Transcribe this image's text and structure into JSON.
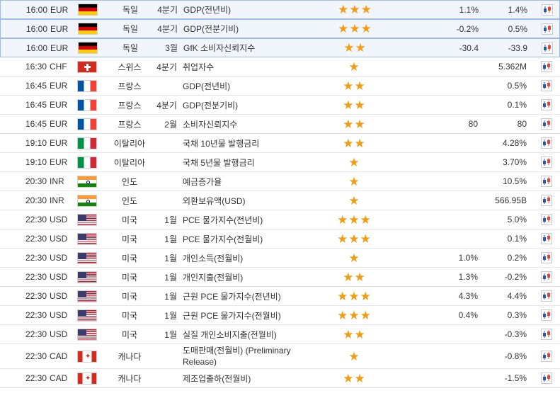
{
  "colors": {
    "star": "#f39c12",
    "row_border": "#e2e4e8",
    "highlight_bg": "#f1f6fd",
    "highlight_border": "#9fbde6"
  },
  "icons": {
    "importance": "star-icon",
    "chart": "candlestick-chart-icon"
  },
  "rows": [
    {
      "time": "16:00",
      "currency": "EUR",
      "flag": "de",
      "country": "독일",
      "period": "4분기",
      "event": "GDP(전년비)",
      "importance": 3,
      "actual": "1.1%",
      "forecast": "1.4%",
      "highlight": true
    },
    {
      "time": "16:00",
      "currency": "EUR",
      "flag": "de",
      "country": "독일",
      "period": "4분기",
      "event": "GDP(전분기비)",
      "importance": 3,
      "actual": "-0.2%",
      "forecast": "0.5%",
      "highlight": true
    },
    {
      "time": "16:00",
      "currency": "EUR",
      "flag": "de",
      "country": "독일",
      "period": "3월",
      "event": "GfK 소비자신뢰지수",
      "importance": 2,
      "actual": "-30.4",
      "forecast": "-33.9",
      "highlight": true
    },
    {
      "time": "16:30",
      "currency": "CHF",
      "flag": "ch",
      "country": "스위스",
      "period": "4분기",
      "event": "취업자수",
      "importance": 1,
      "actual": "",
      "forecast": "5.362M",
      "highlight": false
    },
    {
      "time": "16:45",
      "currency": "EUR",
      "flag": "fr",
      "country": "프랑스",
      "period": "",
      "event": "GDP(전년비)",
      "importance": 2,
      "actual": "",
      "forecast": "0.5%",
      "highlight": false
    },
    {
      "time": "16:45",
      "currency": "EUR",
      "flag": "fr",
      "country": "프랑스",
      "period": "4분기",
      "event": "GDP(전분기비)",
      "importance": 2,
      "actual": "",
      "forecast": "0.1%",
      "highlight": false
    },
    {
      "time": "16:45",
      "currency": "EUR",
      "flag": "fr",
      "country": "프랑스",
      "period": "2월",
      "event": "소비자신뢰지수",
      "importance": 2,
      "actual": "80",
      "forecast": "80",
      "highlight": false
    },
    {
      "time": "19:10",
      "currency": "EUR",
      "flag": "it",
      "country": "이탈리아",
      "period": "",
      "event": "국채 10년물 발행금리",
      "importance": 2,
      "actual": "",
      "forecast": "4.28%",
      "highlight": false
    },
    {
      "time": "19:10",
      "currency": "EUR",
      "flag": "it",
      "country": "이탈리아",
      "period": "",
      "event": "국채 5년물 발행금리",
      "importance": 1,
      "actual": "",
      "forecast": "3.70%",
      "highlight": false
    },
    {
      "time": "20:30",
      "currency": "INR",
      "flag": "in",
      "country": "인도",
      "period": "",
      "event": "예금증가율",
      "importance": 1,
      "actual": "",
      "forecast": "10.5%",
      "highlight": false
    },
    {
      "time": "20:30",
      "currency": "INR",
      "flag": "in",
      "country": "인도",
      "period": "",
      "event": "외환보유액(USD)",
      "importance": 1,
      "actual": "",
      "forecast": "566.95B",
      "highlight": false
    },
    {
      "time": "22:30",
      "currency": "USD",
      "flag": "us",
      "country": "미국",
      "period": "1월",
      "event": "PCE 물가지수(전년비)",
      "importance": 3,
      "actual": "",
      "forecast": "5.0%",
      "highlight": false
    },
    {
      "time": "22:30",
      "currency": "USD",
      "flag": "us",
      "country": "미국",
      "period": "1월",
      "event": "PCE 물가지수(전월비)",
      "importance": 3,
      "actual": "",
      "forecast": "0.1%",
      "highlight": false
    },
    {
      "time": "22:30",
      "currency": "USD",
      "flag": "us",
      "country": "미국",
      "period": "1월",
      "event": "개인소득(전월비)",
      "importance": 1,
      "actual": "1.0%",
      "forecast": "0.2%",
      "highlight": false
    },
    {
      "time": "22:30",
      "currency": "USD",
      "flag": "us",
      "country": "미국",
      "period": "1월",
      "event": "개인지출(전월비)",
      "importance": 2,
      "actual": "1.3%",
      "forecast": "-0.2%",
      "highlight": false
    },
    {
      "time": "22:30",
      "currency": "USD",
      "flag": "us",
      "country": "미국",
      "period": "1월",
      "event": "근원 PCE 물가지수(전년비)",
      "importance": 3,
      "actual": "4.3%",
      "forecast": "4.4%",
      "highlight": false
    },
    {
      "time": "22:30",
      "currency": "USD",
      "flag": "us",
      "country": "미국",
      "period": "1월",
      "event": "근원 PCE 물가지수(전월비)",
      "importance": 3,
      "actual": "0.4%",
      "forecast": "0.3%",
      "highlight": false
    },
    {
      "time": "22:30",
      "currency": "USD",
      "flag": "us",
      "country": "미국",
      "period": "1월",
      "event": "실질 개인소비지출(전월비)",
      "importance": 2,
      "actual": "",
      "forecast": "-0.3%",
      "highlight": false
    },
    {
      "time": "22:30",
      "currency": "CAD",
      "flag": "ca",
      "country": "캐나다",
      "period": "",
      "event": "도매판매(전월비) (Preliminary Release)",
      "importance": 1,
      "actual": "",
      "forecast": "-0.8%",
      "highlight": false,
      "tall": true
    },
    {
      "time": "22:30",
      "currency": "CAD",
      "flag": "ca",
      "country": "캐나다",
      "period": "",
      "event": "제조업출하(전월비)",
      "importance": 2,
      "actual": "",
      "forecast": "-1.5%",
      "highlight": false
    }
  ]
}
